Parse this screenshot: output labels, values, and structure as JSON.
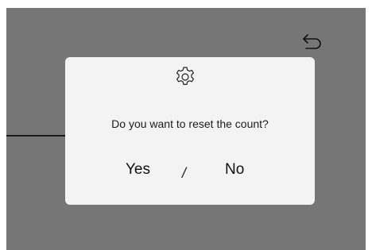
{
  "dialog": {
    "message": "Do you want to reset the count?",
    "yes_label": "Yes",
    "separator": "/",
    "no_label": "No"
  },
  "icons": {
    "back": "back-arrow-icon",
    "settings": "gear-icon"
  },
  "colors": {
    "backdrop": "#777676",
    "dialog_bg": "#f3f3f3",
    "text": "#1c1c1c"
  }
}
